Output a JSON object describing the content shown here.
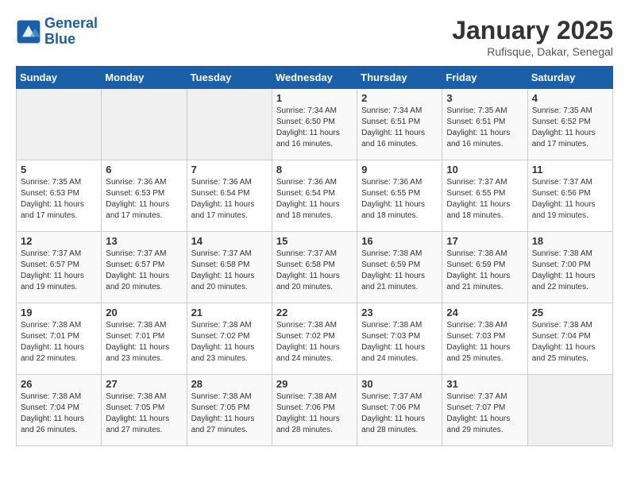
{
  "header": {
    "logo_line1": "General",
    "logo_line2": "Blue",
    "month": "January 2025",
    "location": "Rufisque, Dakar, Senegal"
  },
  "weekdays": [
    "Sunday",
    "Monday",
    "Tuesday",
    "Wednesday",
    "Thursday",
    "Friday",
    "Saturday"
  ],
  "weeks": [
    [
      {
        "day": "",
        "info": ""
      },
      {
        "day": "",
        "info": ""
      },
      {
        "day": "",
        "info": ""
      },
      {
        "day": "1",
        "info": "Sunrise: 7:34 AM\nSunset: 6:50 PM\nDaylight: 11 hours\nand 16 minutes."
      },
      {
        "day": "2",
        "info": "Sunrise: 7:34 AM\nSunset: 6:51 PM\nDaylight: 11 hours\nand 16 minutes."
      },
      {
        "day": "3",
        "info": "Sunrise: 7:35 AM\nSunset: 6:51 PM\nDaylight: 11 hours\nand 16 minutes."
      },
      {
        "day": "4",
        "info": "Sunrise: 7:35 AM\nSunset: 6:52 PM\nDaylight: 11 hours\nand 17 minutes."
      }
    ],
    [
      {
        "day": "5",
        "info": "Sunrise: 7:35 AM\nSunset: 6:53 PM\nDaylight: 11 hours\nand 17 minutes."
      },
      {
        "day": "6",
        "info": "Sunrise: 7:36 AM\nSunset: 6:53 PM\nDaylight: 11 hours\nand 17 minutes."
      },
      {
        "day": "7",
        "info": "Sunrise: 7:36 AM\nSunset: 6:54 PM\nDaylight: 11 hours\nand 17 minutes."
      },
      {
        "day": "8",
        "info": "Sunrise: 7:36 AM\nSunset: 6:54 PM\nDaylight: 11 hours\nand 18 minutes."
      },
      {
        "day": "9",
        "info": "Sunrise: 7:36 AM\nSunset: 6:55 PM\nDaylight: 11 hours\nand 18 minutes."
      },
      {
        "day": "10",
        "info": "Sunrise: 7:37 AM\nSunset: 6:55 PM\nDaylight: 11 hours\nand 18 minutes."
      },
      {
        "day": "11",
        "info": "Sunrise: 7:37 AM\nSunset: 6:56 PM\nDaylight: 11 hours\nand 19 minutes."
      }
    ],
    [
      {
        "day": "12",
        "info": "Sunrise: 7:37 AM\nSunset: 6:57 PM\nDaylight: 11 hours\nand 19 minutes."
      },
      {
        "day": "13",
        "info": "Sunrise: 7:37 AM\nSunset: 6:57 PM\nDaylight: 11 hours\nand 20 minutes."
      },
      {
        "day": "14",
        "info": "Sunrise: 7:37 AM\nSunset: 6:58 PM\nDaylight: 11 hours\nand 20 minutes."
      },
      {
        "day": "15",
        "info": "Sunrise: 7:37 AM\nSunset: 6:58 PM\nDaylight: 11 hours\nand 20 minutes."
      },
      {
        "day": "16",
        "info": "Sunrise: 7:38 AM\nSunset: 6:59 PM\nDaylight: 11 hours\nand 21 minutes."
      },
      {
        "day": "17",
        "info": "Sunrise: 7:38 AM\nSunset: 6:59 PM\nDaylight: 11 hours\nand 21 minutes."
      },
      {
        "day": "18",
        "info": "Sunrise: 7:38 AM\nSunset: 7:00 PM\nDaylight: 11 hours\nand 22 minutes."
      }
    ],
    [
      {
        "day": "19",
        "info": "Sunrise: 7:38 AM\nSunset: 7:01 PM\nDaylight: 11 hours\nand 22 minutes."
      },
      {
        "day": "20",
        "info": "Sunrise: 7:38 AM\nSunset: 7:01 PM\nDaylight: 11 hours\nand 23 minutes."
      },
      {
        "day": "21",
        "info": "Sunrise: 7:38 AM\nSunset: 7:02 PM\nDaylight: 11 hours\nand 23 minutes."
      },
      {
        "day": "22",
        "info": "Sunrise: 7:38 AM\nSunset: 7:02 PM\nDaylight: 11 hours\nand 24 minutes."
      },
      {
        "day": "23",
        "info": "Sunrise: 7:38 AM\nSunset: 7:03 PM\nDaylight: 11 hours\nand 24 minutes."
      },
      {
        "day": "24",
        "info": "Sunrise: 7:38 AM\nSunset: 7:03 PM\nDaylight: 11 hours\nand 25 minutes."
      },
      {
        "day": "25",
        "info": "Sunrise: 7:38 AM\nSunset: 7:04 PM\nDaylight: 11 hours\nand 25 minutes."
      }
    ],
    [
      {
        "day": "26",
        "info": "Sunrise: 7:38 AM\nSunset: 7:04 PM\nDaylight: 11 hours\nand 26 minutes."
      },
      {
        "day": "27",
        "info": "Sunrise: 7:38 AM\nSunset: 7:05 PM\nDaylight: 11 hours\nand 27 minutes."
      },
      {
        "day": "28",
        "info": "Sunrise: 7:38 AM\nSunset: 7:05 PM\nDaylight: 11 hours\nand 27 minutes."
      },
      {
        "day": "29",
        "info": "Sunrise: 7:38 AM\nSunset: 7:06 PM\nDaylight: 11 hours\nand 28 minutes."
      },
      {
        "day": "30",
        "info": "Sunrise: 7:37 AM\nSunset: 7:06 PM\nDaylight: 11 hours\nand 28 minutes."
      },
      {
        "day": "31",
        "info": "Sunrise: 7:37 AM\nSunset: 7:07 PM\nDaylight: 11 hours\nand 29 minutes."
      },
      {
        "day": "",
        "info": ""
      }
    ]
  ]
}
